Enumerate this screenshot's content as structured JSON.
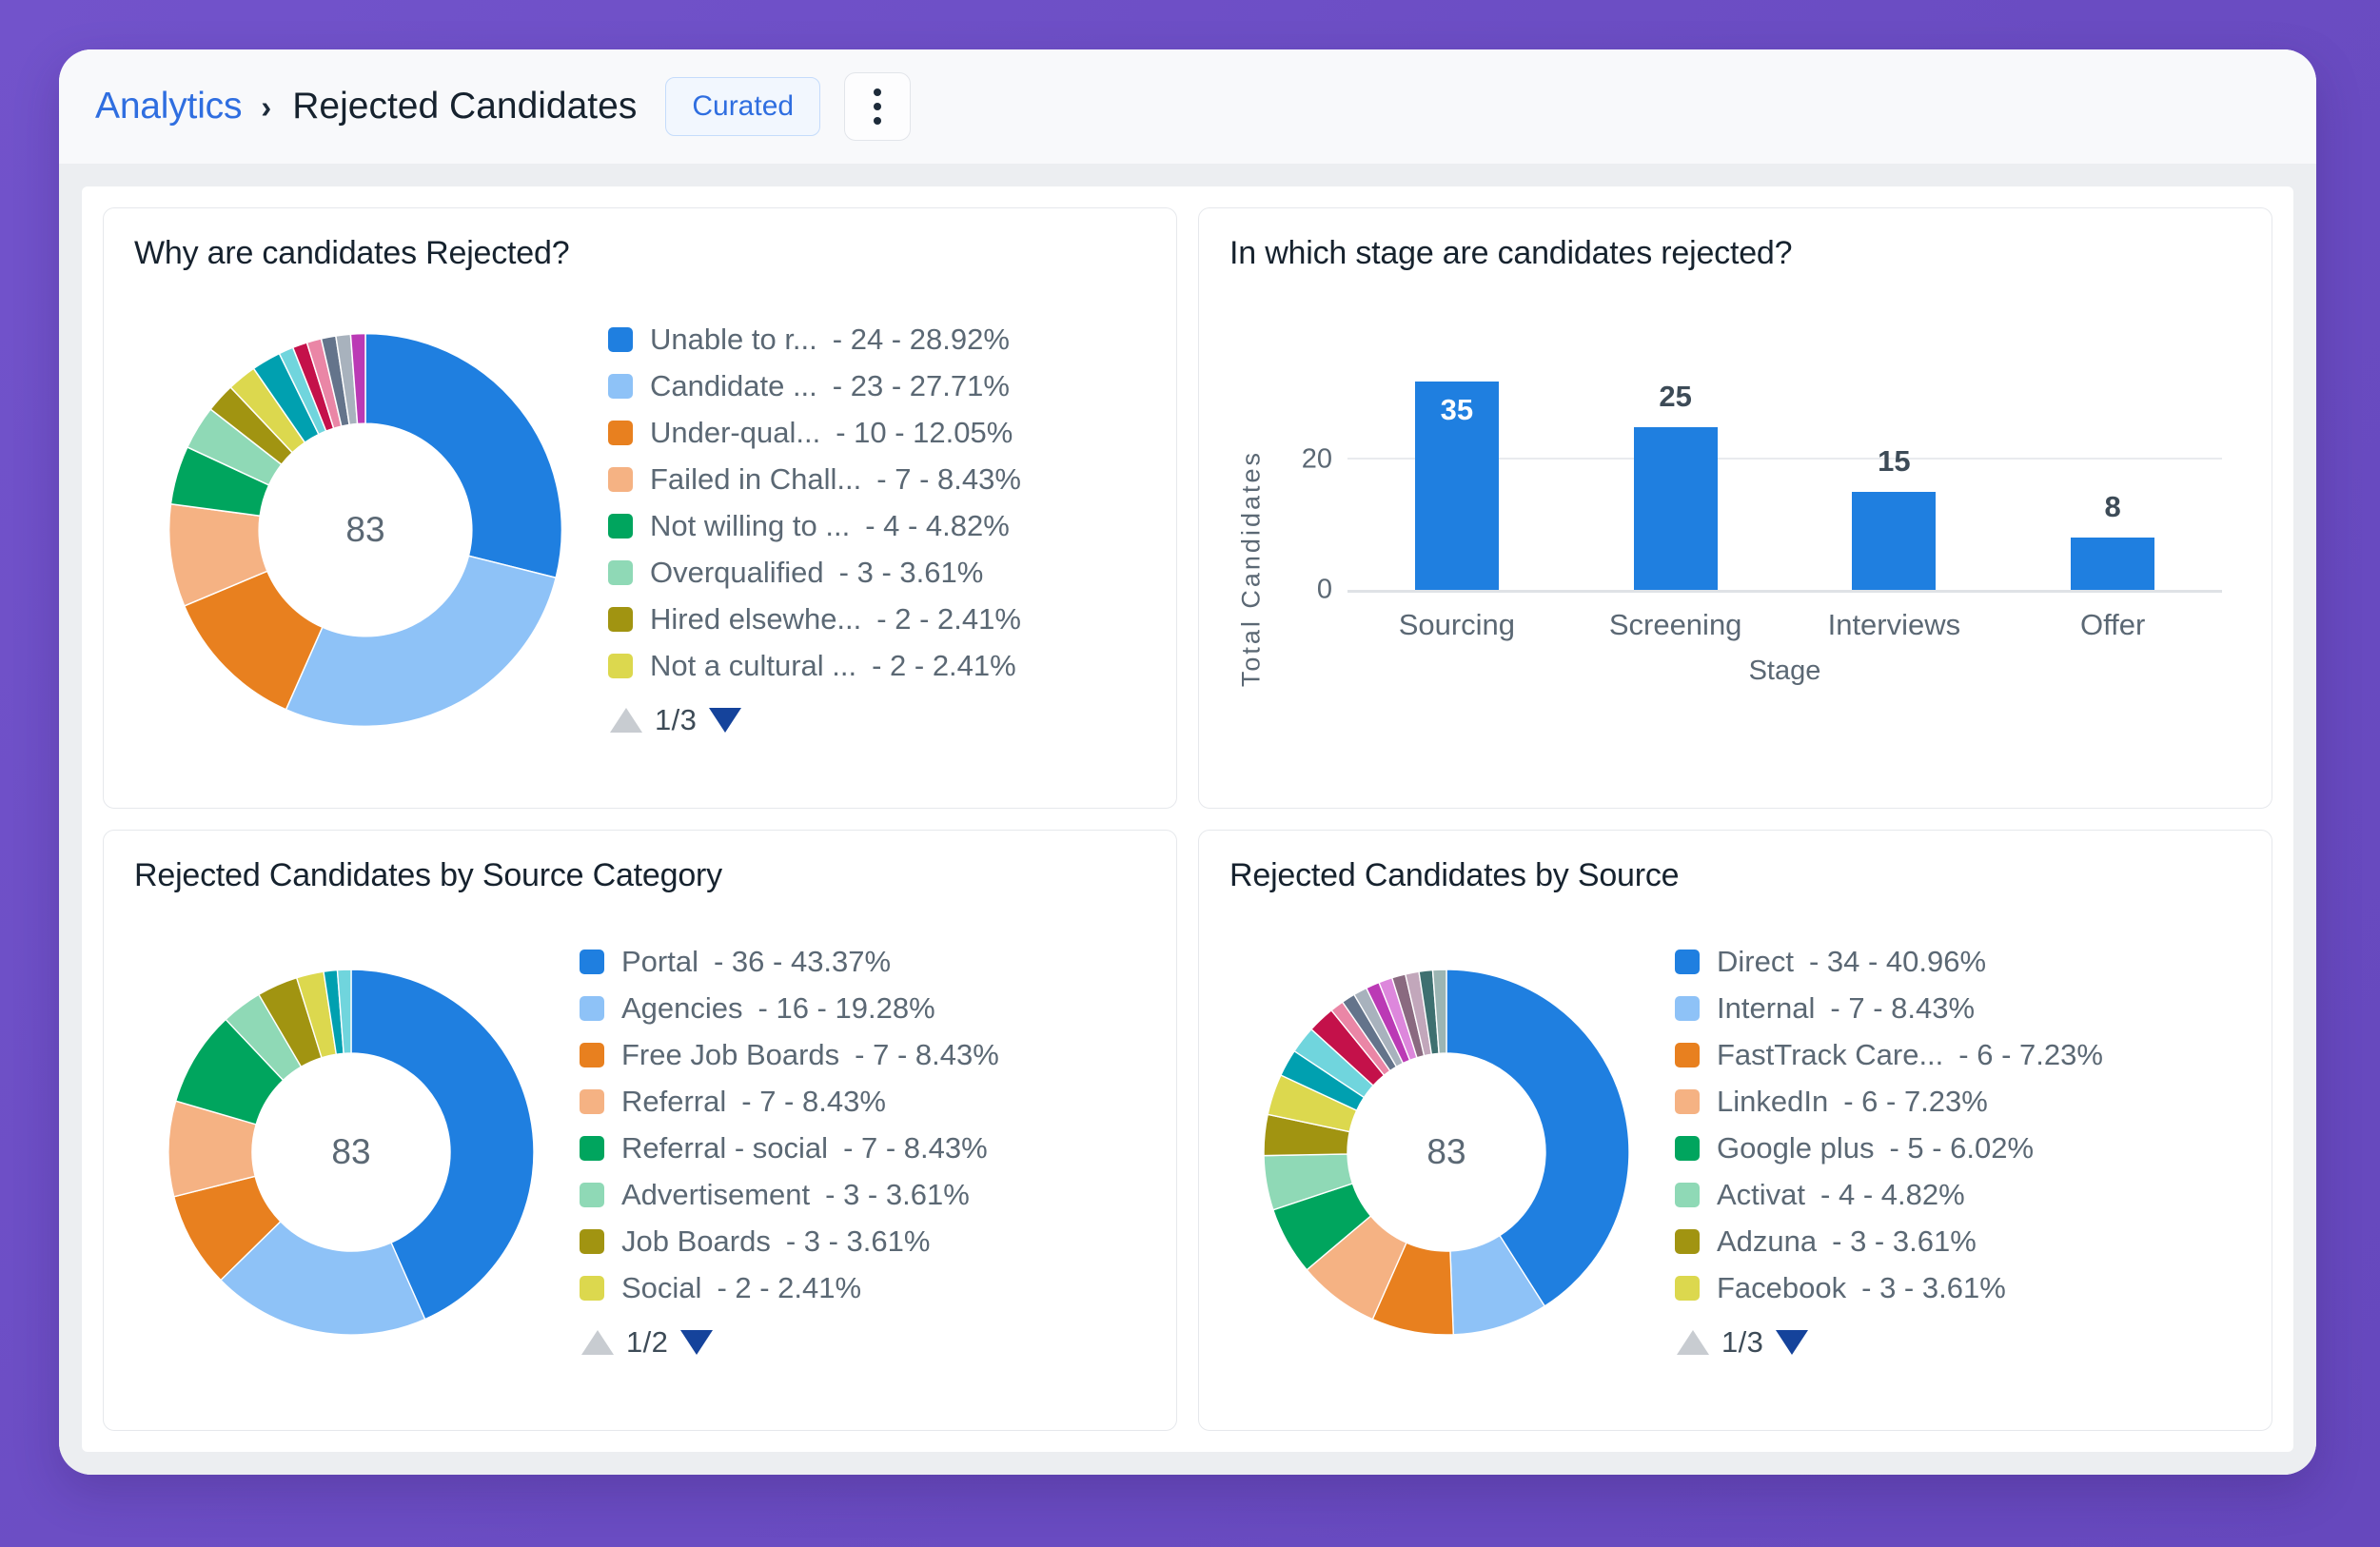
{
  "header": {
    "breadcrumb_root": "Analytics",
    "breadcrumb_separator": "›",
    "breadcrumb_current": "Rejected Candidates",
    "badge_label": "Curated"
  },
  "cards": {
    "rejection_reasons": {
      "title": "Why are candidates Rejected?",
      "center_total": "83",
      "pager": "1/3"
    },
    "rejection_stage": {
      "title": "In which stage are candidates rejected?"
    },
    "source_category": {
      "title": "Rejected Candidates by Source Category",
      "center_total": "83",
      "pager": "1/2"
    },
    "source": {
      "title": "Rejected Candidates by Source",
      "center_total": "83",
      "pager": "1/3"
    }
  },
  "palette": {
    "blue": "#1f7fe0",
    "light_blue": "#8ec2f7",
    "orange": "#e8801f",
    "light_orange": "#f5b283",
    "green": "#00a55e",
    "light_green": "#8fd9b6",
    "olive": "#a19411",
    "yellow": "#dcd84e",
    "teal": "#00a0b0",
    "light_teal": "#70d5dd",
    "crimson": "#c4114a",
    "pink": "#ea86a6",
    "slate": "#64748b",
    "light_slate": "#a8b2bd",
    "magenta": "#bb3ab5",
    "light_magenta": "#dd87dc",
    "mauve": "#8a6a80",
    "light_mauve": "#c2a7bb",
    "dark_teal": "#3e7070",
    "pale_teal": "#9bb5b3",
    "bar_blue": "#1f7fe0"
  },
  "chart_data": [
    {
      "id": "rejection_reasons",
      "type": "pie",
      "title": "Why are candidates Rejected?",
      "total": 83,
      "center_label": "83",
      "legend_position": "right",
      "page": "1/3",
      "labels": [
        "Unable to r...",
        "Candidate ...",
        "Under-qual...",
        "Failed in Chall...",
        "Not willing to ...",
        "Overqualified",
        "Hired elsewhe...",
        "Not a cultural ..."
      ],
      "values": [
        24,
        23,
        10,
        7,
        4,
        3,
        2,
        2
      ],
      "percents": [
        "28.92%",
        "27.71%",
        "12.05%",
        "8.43%",
        "4.82%",
        "3.61%",
        "2.41%",
        "2.41%"
      ],
      "value_text": [
        "- 24 - 28.92%",
        "- 23 - 27.71%",
        "- 10 - 12.05%",
        "- 7 - 8.43%",
        "- 4 - 4.82%",
        "- 3 - 3.61%",
        "- 2 - 2.41%",
        "- 2 - 2.41%"
      ],
      "colors": [
        "#1f7fe0",
        "#8ec2f7",
        "#e8801f",
        "#f5b283",
        "#00a55e",
        "#8fd9b6",
        "#a19411",
        "#dcd84e"
      ],
      "slices": [
        {
          "color": "#1f7fe0",
          "value": 24
        },
        {
          "color": "#8ec2f7",
          "value": 23
        },
        {
          "color": "#e8801f",
          "value": 10
        },
        {
          "color": "#f5b283",
          "value": 7
        },
        {
          "color": "#00a55e",
          "value": 4
        },
        {
          "color": "#8fd9b6",
          "value": 3
        },
        {
          "color": "#a19411",
          "value": 2
        },
        {
          "color": "#dcd84e",
          "value": 2
        },
        {
          "color": "#00a0b0",
          "value": 2
        },
        {
          "color": "#70d5dd",
          "value": 1
        },
        {
          "color": "#c4114a",
          "value": 1
        },
        {
          "color": "#ea86a6",
          "value": 1
        },
        {
          "color": "#64748b",
          "value": 1
        },
        {
          "color": "#a8b2bd",
          "value": 1
        },
        {
          "color": "#bb3ab5",
          "value": 1
        }
      ]
    },
    {
      "id": "rejection_stage",
      "type": "bar",
      "title": "In which stage are candidates rejected?",
      "categories": [
        "Sourcing",
        "Screening",
        "Interviews",
        "Offer"
      ],
      "values": [
        35,
        25,
        15,
        8
      ],
      "xlabel": "Stage",
      "ylabel": "Total Candidates",
      "yticks": [
        0,
        20
      ],
      "ylim": [
        0,
        32
      ],
      "grid": true,
      "bar_color": "#1f7fe0",
      "labels_inside": [
        true,
        false,
        false,
        false
      ]
    },
    {
      "id": "source_category",
      "type": "pie",
      "title": "Rejected Candidates by Source Category",
      "total": 83,
      "center_label": "83",
      "legend_position": "right",
      "page": "1/2",
      "labels": [
        "Portal",
        "Agencies",
        "Free Job Boards",
        "Referral",
        "Referral - social",
        "Advertisement",
        "Job Boards",
        "Social"
      ],
      "values": [
        36,
        16,
        7,
        7,
        7,
        3,
        3,
        2
      ],
      "percents": [
        "43.37%",
        "19.28%",
        "8.43%",
        "8.43%",
        "8.43%",
        "3.61%",
        "3.61%",
        "2.41%"
      ],
      "value_text": [
        "- 36 - 43.37%",
        "- 16 - 19.28%",
        "- 7 - 8.43%",
        "- 7 - 8.43%",
        "- 7 - 8.43%",
        "- 3 - 3.61%",
        "- 3 - 3.61%",
        "- 2 - 2.41%"
      ],
      "colors": [
        "#1f7fe0",
        "#8ec2f7",
        "#e8801f",
        "#f5b283",
        "#00a55e",
        "#8fd9b6",
        "#a19411",
        "#dcd84e"
      ],
      "slices": [
        {
          "color": "#1f7fe0",
          "value": 36
        },
        {
          "color": "#8ec2f7",
          "value": 16
        },
        {
          "color": "#e8801f",
          "value": 7
        },
        {
          "color": "#f5b283",
          "value": 7
        },
        {
          "color": "#00a55e",
          "value": 7
        },
        {
          "color": "#8fd9b6",
          "value": 3
        },
        {
          "color": "#a19411",
          "value": 3
        },
        {
          "color": "#dcd84e",
          "value": 2
        },
        {
          "color": "#00a0b0",
          "value": 1
        },
        {
          "color": "#70d5dd",
          "value": 1
        }
      ]
    },
    {
      "id": "source",
      "type": "pie",
      "title": "Rejected Candidates by Source",
      "total": 83,
      "center_label": "83",
      "legend_position": "right",
      "page": "1/3",
      "labels": [
        "Direct",
        "Internal",
        "FastTrack Care...",
        "LinkedIn",
        "Google plus",
        "Activat",
        "Adzuna",
        "Facebook"
      ],
      "values": [
        34,
        7,
        6,
        6,
        5,
        4,
        3,
        3
      ],
      "percents": [
        "40.96%",
        "8.43%",
        "7.23%",
        "7.23%",
        "6.02%",
        "4.82%",
        "3.61%",
        "3.61%"
      ],
      "value_text": [
        "- 34 - 40.96%",
        "- 7 - 8.43%",
        "- 6 - 7.23%",
        "- 6 - 7.23%",
        "- 5 - 6.02%",
        "- 4 - 4.82%",
        "- 3 - 3.61%",
        "- 3 - 3.61%"
      ],
      "colors": [
        "#1f7fe0",
        "#8ec2f7",
        "#e8801f",
        "#f5b283",
        "#00a55e",
        "#8fd9b6",
        "#a19411",
        "#dcd84e"
      ],
      "slices": [
        {
          "color": "#1f7fe0",
          "value": 34
        },
        {
          "color": "#8ec2f7",
          "value": 7
        },
        {
          "color": "#e8801f",
          "value": 6
        },
        {
          "color": "#f5b283",
          "value": 6
        },
        {
          "color": "#00a55e",
          "value": 5
        },
        {
          "color": "#8fd9b6",
          "value": 4
        },
        {
          "color": "#a19411",
          "value": 3
        },
        {
          "color": "#dcd84e",
          "value": 3
        },
        {
          "color": "#00a0b0",
          "value": 2
        },
        {
          "color": "#70d5dd",
          "value": 2
        },
        {
          "color": "#c4114a",
          "value": 2
        },
        {
          "color": "#ea86a6",
          "value": 1
        },
        {
          "color": "#64748b",
          "value": 1
        },
        {
          "color": "#a8b2bd",
          "value": 1
        },
        {
          "color": "#bb3ab5",
          "value": 1
        },
        {
          "color": "#dd87dc",
          "value": 1
        },
        {
          "color": "#8a6a80",
          "value": 1
        },
        {
          "color": "#c2a7bb",
          "value": 1
        },
        {
          "color": "#3e7070",
          "value": 1
        },
        {
          "color": "#9bb5b3",
          "value": 1
        }
      ]
    }
  ]
}
